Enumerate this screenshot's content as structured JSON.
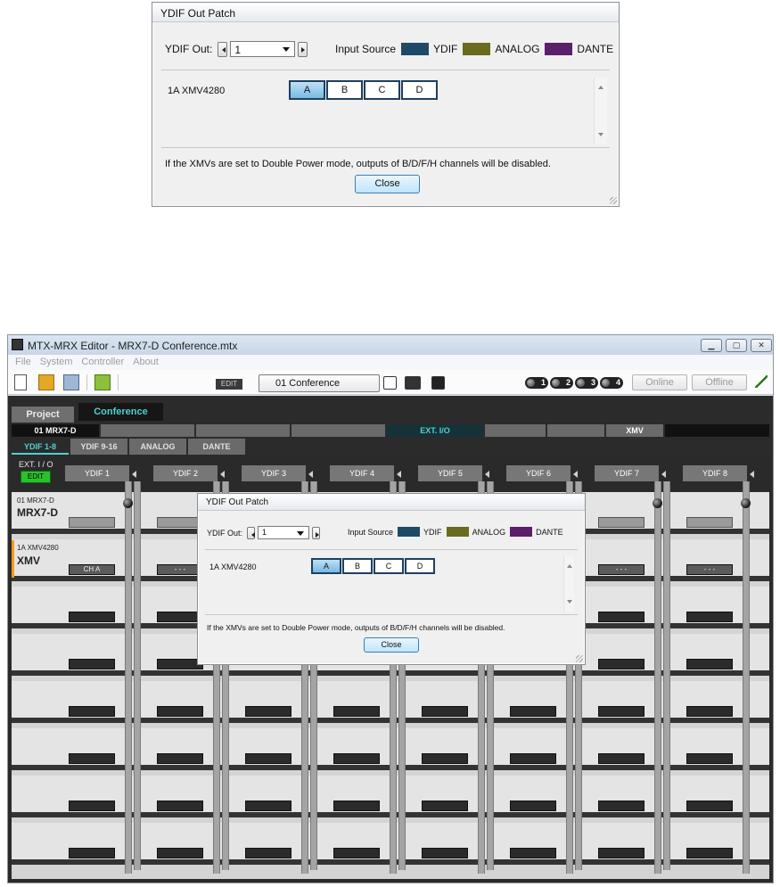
{
  "dialog": {
    "title": "YDIF Out Patch",
    "ydif_out_label": "YDIF Out:",
    "ydif_out_value": "1",
    "input_source_label": "Input Source",
    "legend": [
      {
        "label": "YDIF",
        "color": "#1f4a66"
      },
      {
        "label": "ANALOG",
        "color": "#6b6b1f"
      },
      {
        "label": "DANTE",
        "color": "#5b1f6b"
      }
    ],
    "device_label": "1A XMV4280",
    "patch_buttons": [
      "A",
      "B",
      "C",
      "D"
    ],
    "selected_patch": "A",
    "note": "If the XMVs are set to Double Power mode, outputs of  B/D/F/H channels will be disabled.",
    "close_label": "Close"
  },
  "window": {
    "title": "MTX-MRX Editor - MRX7-D Conference.mtx",
    "menu": [
      "File",
      "System",
      "Controller",
      "About"
    ],
    "toolbar": {
      "edit_badge": "EDIT",
      "preset": "01 Conference",
      "indicators": [
        "1",
        "2",
        "3",
        "4"
      ],
      "online": "Online",
      "offline": "Offline"
    },
    "tabs": [
      "Project",
      "Conference"
    ],
    "device_row": {
      "device": "01 MRX7-D",
      "extio": "EXT. I/O",
      "xmv": "XMV"
    },
    "subtabs": [
      "YDIF 1-8",
      "YDIF 9-16",
      "ANALOG",
      "DANTE"
    ],
    "extio_label": "EXT. I / O",
    "edit_green": "EDIT",
    "channels": [
      "YDIF 1",
      "YDIF 2",
      "YDIF 3",
      "YDIF 4",
      "YDIF 5",
      "YDIF 6",
      "YDIF 7",
      "YDIF 8"
    ],
    "rows": {
      "mrx_id": "01 MRX7-D",
      "mrx_name": "MRX7-D",
      "xmv_id": "1A XMV4280",
      "xmv_name": "XMV",
      "xmv_cell": "CH A",
      "empty_cell": "- - -"
    }
  }
}
